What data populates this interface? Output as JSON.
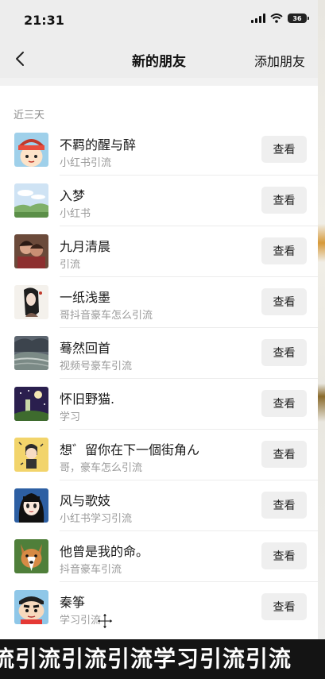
{
  "status_bar": {
    "time": "21:31",
    "battery": "36"
  },
  "nav": {
    "title": "新的朋友",
    "action": "添加朋友"
  },
  "section_header": "近三天",
  "view_label": "查看",
  "friends": [
    {
      "name": "不羁的醒与醉",
      "source": "小红书引流",
      "avatar": "cartoon-girl"
    },
    {
      "name": "入梦",
      "source": "小红书",
      "avatar": "sky-landscape"
    },
    {
      "name": "九月清晨",
      "source": "引流",
      "avatar": "couple-photo"
    },
    {
      "name": "一纸浅墨",
      "source": "哥抖音豪车怎么引流",
      "avatar": "ink-sketch-girl"
    },
    {
      "name": "蓦然回首",
      "source": "视频号豪车引流",
      "avatar": "stormy-sea"
    },
    {
      "name": "怀旧野猫.",
      "source": "学习",
      "avatar": "night-scene"
    },
    {
      "name": "想゛留你在下一個街角ん",
      "source": "哥，豪车怎么引流",
      "avatar": "cartoon-boy"
    },
    {
      "name": "风与歌妓",
      "source": "小红书学习引流",
      "avatar": "anime-girl"
    },
    {
      "name": "他曾是我的命。",
      "source": "抖音豪车引流",
      "avatar": "corgi-dog"
    },
    {
      "name": "秦筝",
      "source": "学习引流",
      "avatar": "crayon-shinchan"
    }
  ],
  "caption": "流引流引流引流学习引流引流"
}
